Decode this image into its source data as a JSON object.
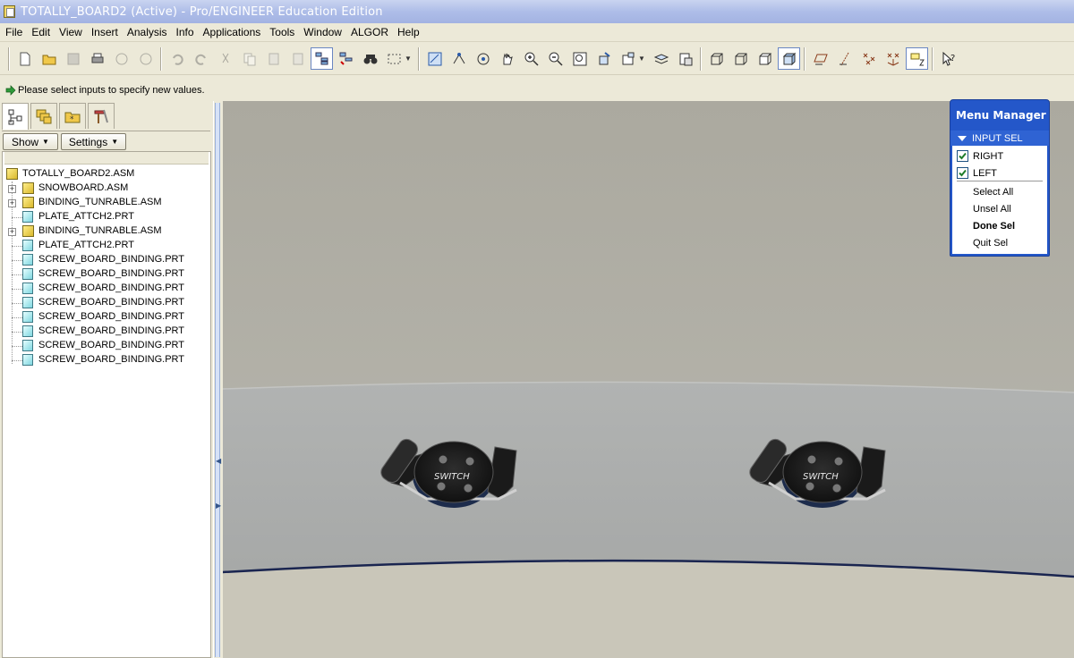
{
  "window": {
    "title": "TOTALLY_BOARD2 (Active) - Pro/ENGINEER Education Edition"
  },
  "menubar": [
    "File",
    "Edit",
    "View",
    "Insert",
    "Analysis",
    "Info",
    "Applications",
    "Tools",
    "Window",
    "ALGOR",
    "Help"
  ],
  "message": {
    "text": "Please select inputs to specify new values."
  },
  "panel": {
    "show_label": "Show",
    "settings_label": "Settings"
  },
  "tree": {
    "root": "TOTALLY_BOARD2.ASM",
    "items": [
      {
        "label": "SNOWBOARD.ASM",
        "type": "asm",
        "expandable": true
      },
      {
        "label": "BINDING_TUNRABLE.ASM",
        "type": "asm",
        "expandable": true
      },
      {
        "label": "PLATE_ATTCH2.PRT",
        "type": "prt",
        "expandable": false
      },
      {
        "label": "BINDING_TUNRABLE.ASM",
        "type": "asm",
        "expandable": true
      },
      {
        "label": "PLATE_ATTCH2.PRT",
        "type": "prt",
        "expandable": false
      },
      {
        "label": "SCREW_BOARD_BINDING.PRT",
        "type": "prt",
        "expandable": false
      },
      {
        "label": "SCREW_BOARD_BINDING.PRT",
        "type": "prt",
        "expandable": false
      },
      {
        "label": "SCREW_BOARD_BINDING.PRT",
        "type": "prt",
        "expandable": false
      },
      {
        "label": "SCREW_BOARD_BINDING.PRT",
        "type": "prt",
        "expandable": false
      },
      {
        "label": "SCREW_BOARD_BINDING.PRT",
        "type": "prt",
        "expandable": false
      },
      {
        "label": "SCREW_BOARD_BINDING.PRT",
        "type": "prt",
        "expandable": false
      },
      {
        "label": "SCREW_BOARD_BINDING.PRT",
        "type": "prt",
        "expandable": false
      },
      {
        "label": "SCREW_BOARD_BINDING.PRT",
        "type": "prt",
        "expandable": false
      }
    ]
  },
  "menu_manager": {
    "title": "Menu Manager",
    "submenu": "INPUT SEL",
    "options": [
      {
        "label": "RIGHT",
        "checked": true
      },
      {
        "label": "LEFT",
        "checked": true
      }
    ],
    "actions": {
      "select_all": "Select All",
      "unsel_all": "Unsel All",
      "done_sel": "Done Sel",
      "quit_sel": "Quit Sel"
    }
  },
  "graphics": {
    "binding_text": "SWITCH",
    "colors": {
      "upper_bg": "#b2b0a6",
      "lower_bg": "#a7a9a8",
      "floor": "#c8c5b8",
      "edge": "#1a2550"
    }
  },
  "colors": {
    "accent": "#2457c9",
    "titlebar": "#aebde8",
    "chrome": "#ece9d8"
  }
}
